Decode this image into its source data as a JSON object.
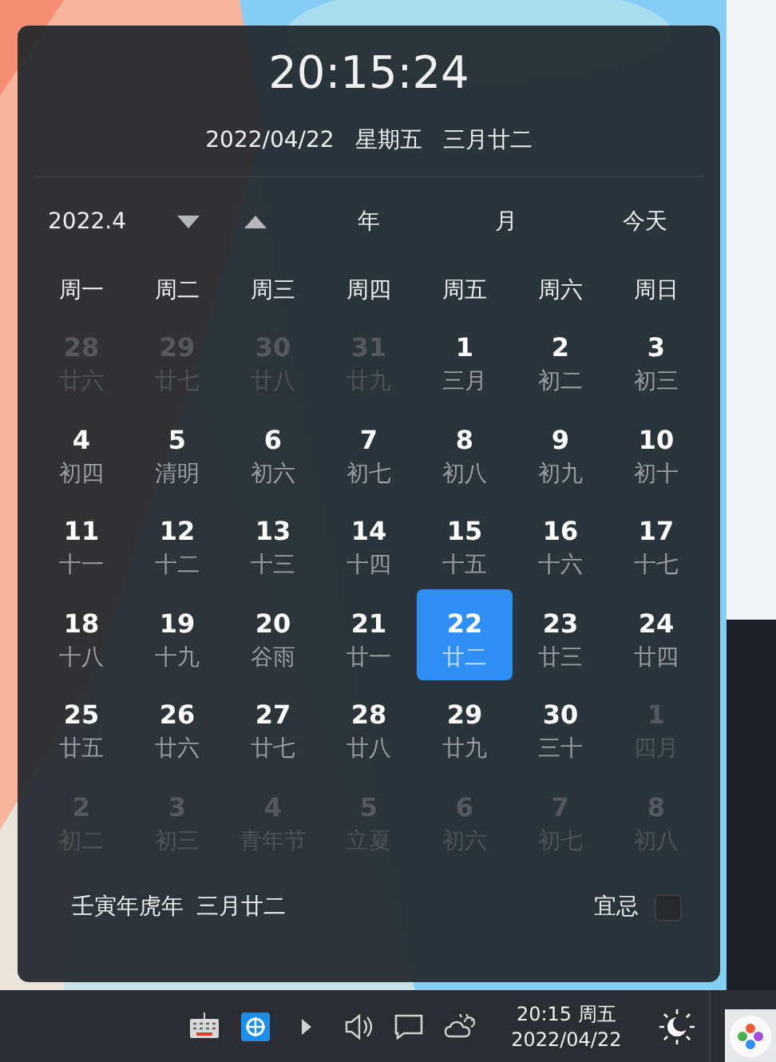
{
  "clock": {
    "time": "20:15:24",
    "date": "2022/04/22",
    "weekday": "星期五",
    "lunar": "三月廿二"
  },
  "nav": {
    "month": "2022.4",
    "year_button": "年",
    "month_button": "月",
    "today_button": "今天"
  },
  "weekdays": [
    "周一",
    "周二",
    "周三",
    "周四",
    "周五",
    "周六",
    "周日"
  ],
  "days": [
    {
      "day": "28",
      "lunar": "廿六",
      "in_month": false,
      "selected": false
    },
    {
      "day": "29",
      "lunar": "廿七",
      "in_month": false,
      "selected": false
    },
    {
      "day": "30",
      "lunar": "廿八",
      "in_month": false,
      "selected": false
    },
    {
      "day": "31",
      "lunar": "廿九",
      "in_month": false,
      "selected": false
    },
    {
      "day": "1",
      "lunar": "三月",
      "in_month": true,
      "selected": false
    },
    {
      "day": "2",
      "lunar": "初二",
      "in_month": true,
      "selected": false
    },
    {
      "day": "3",
      "lunar": "初三",
      "in_month": true,
      "selected": false
    },
    {
      "day": "4",
      "lunar": "初四",
      "in_month": true,
      "selected": false
    },
    {
      "day": "5",
      "lunar": "清明",
      "in_month": true,
      "selected": false
    },
    {
      "day": "6",
      "lunar": "初六",
      "in_month": true,
      "selected": false
    },
    {
      "day": "7",
      "lunar": "初七",
      "in_month": true,
      "selected": false
    },
    {
      "day": "8",
      "lunar": "初八",
      "in_month": true,
      "selected": false
    },
    {
      "day": "9",
      "lunar": "初九",
      "in_month": true,
      "selected": false
    },
    {
      "day": "10",
      "lunar": "初十",
      "in_month": true,
      "selected": false
    },
    {
      "day": "11",
      "lunar": "十一",
      "in_month": true,
      "selected": false
    },
    {
      "day": "12",
      "lunar": "十二",
      "in_month": true,
      "selected": false
    },
    {
      "day": "13",
      "lunar": "十三",
      "in_month": true,
      "selected": false
    },
    {
      "day": "14",
      "lunar": "十四",
      "in_month": true,
      "selected": false
    },
    {
      "day": "15",
      "lunar": "十五",
      "in_month": true,
      "selected": false
    },
    {
      "day": "16",
      "lunar": "十六",
      "in_month": true,
      "selected": false
    },
    {
      "day": "17",
      "lunar": "十七",
      "in_month": true,
      "selected": false
    },
    {
      "day": "18",
      "lunar": "十八",
      "in_month": true,
      "selected": false
    },
    {
      "day": "19",
      "lunar": "十九",
      "in_month": true,
      "selected": false
    },
    {
      "day": "20",
      "lunar": "谷雨",
      "in_month": true,
      "selected": false
    },
    {
      "day": "21",
      "lunar": "廿一",
      "in_month": true,
      "selected": false
    },
    {
      "day": "22",
      "lunar": "廿二",
      "in_month": true,
      "selected": true
    },
    {
      "day": "23",
      "lunar": "廿三",
      "in_month": true,
      "selected": false
    },
    {
      "day": "24",
      "lunar": "廿四",
      "in_month": true,
      "selected": false
    },
    {
      "day": "25",
      "lunar": "廿五",
      "in_month": true,
      "selected": false
    },
    {
      "day": "26",
      "lunar": "廿六",
      "in_month": true,
      "selected": false
    },
    {
      "day": "27",
      "lunar": "廿七",
      "in_month": true,
      "selected": false
    },
    {
      "day": "28",
      "lunar": "廿八",
      "in_month": true,
      "selected": false
    },
    {
      "day": "29",
      "lunar": "廿九",
      "in_month": true,
      "selected": false
    },
    {
      "day": "30",
      "lunar": "三十",
      "in_month": true,
      "selected": false
    },
    {
      "day": "1",
      "lunar": "四月",
      "in_month": false,
      "selected": false
    },
    {
      "day": "2",
      "lunar": "初二",
      "in_month": false,
      "selected": false
    },
    {
      "day": "3",
      "lunar": "初三",
      "in_month": false,
      "selected": false
    },
    {
      "day": "4",
      "lunar": "青年节",
      "in_month": false,
      "selected": false
    },
    {
      "day": "5",
      "lunar": "立夏",
      "in_month": false,
      "selected": false
    },
    {
      "day": "6",
      "lunar": "初六",
      "in_month": false,
      "selected": false
    },
    {
      "day": "7",
      "lunar": "初七",
      "in_month": false,
      "selected": false
    },
    {
      "day": "8",
      "lunar": "初八",
      "in_month": false,
      "selected": false
    }
  ],
  "footer": {
    "lunar_year": "壬寅年虎年",
    "lunar_date": "三月廿二",
    "yiji_label": "宜忌",
    "yiji_checked": false
  },
  "taskbar": {
    "time": "20:15 周五",
    "date": "2022/04/22"
  }
}
